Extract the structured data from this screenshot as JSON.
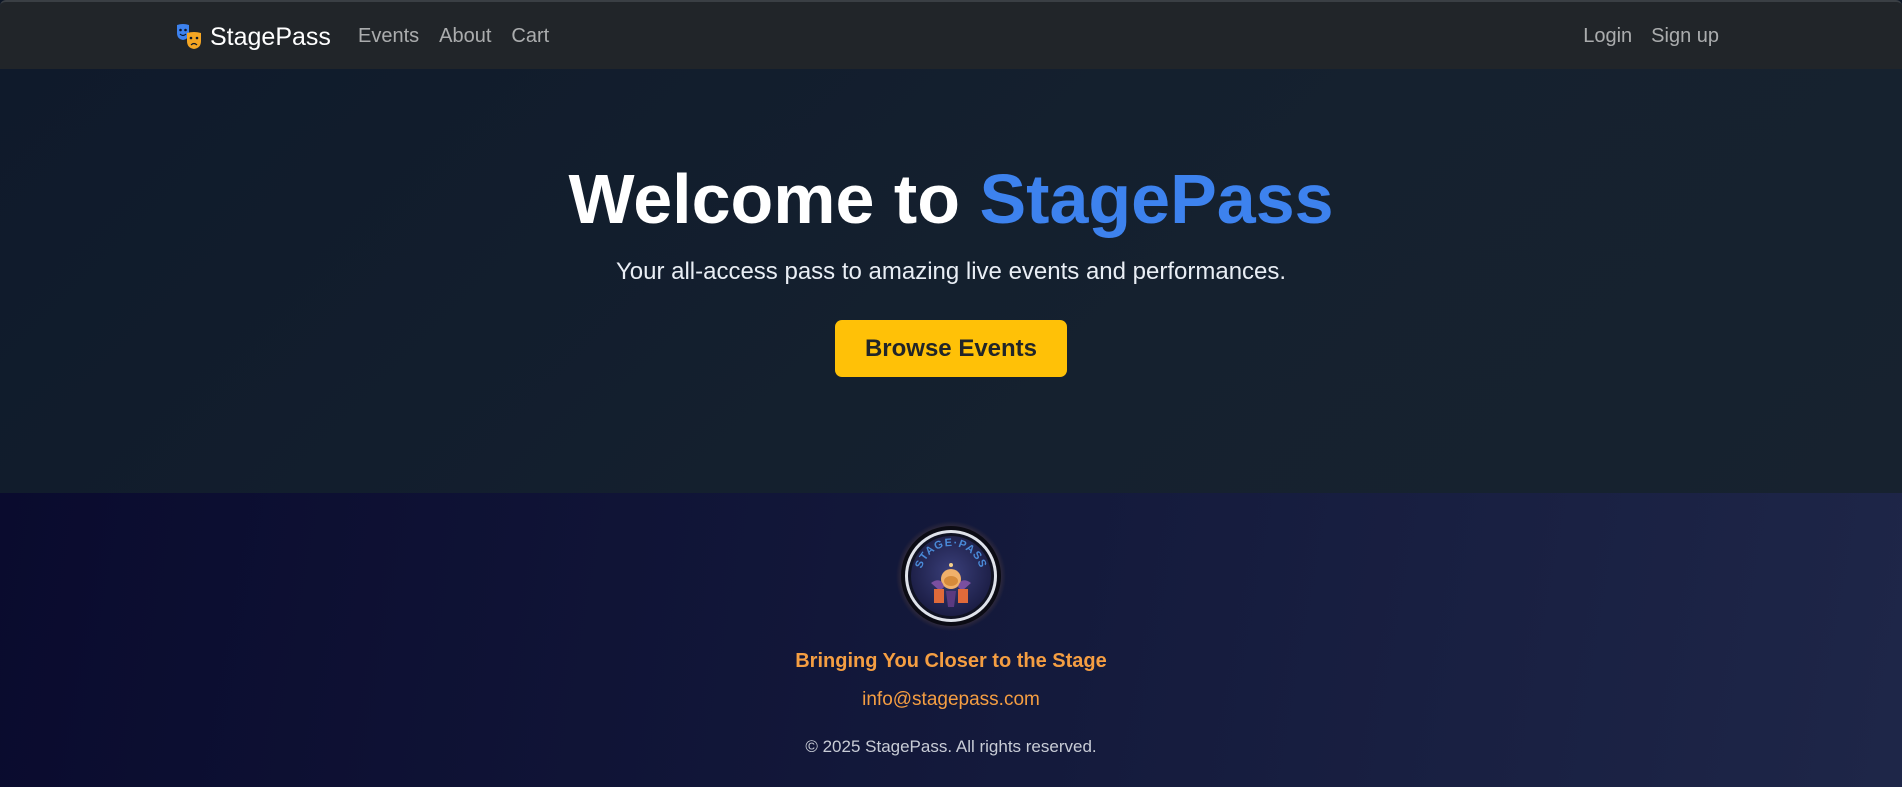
{
  "nav": {
    "brand": "StagePass",
    "brand_icon": "theater-masks-icon",
    "links": [
      "Events",
      "About",
      "Cart"
    ],
    "auth": [
      "Login",
      "Sign up"
    ]
  },
  "hero": {
    "title_prefix": "Welcome to",
    "title_accent": "StagePass",
    "subtitle": "Your all-access pass to amazing live events and performances.",
    "button": "Browse Events"
  },
  "footer": {
    "logo_text": "STAGE·PASS",
    "tagline": "Bringing You Closer to the Stage",
    "email": "info@stagepass.com",
    "copyright": "© 2025 StagePass. All rights reserved."
  },
  "colors": {
    "navbar": "#212529",
    "accent_blue": "#3d82ee",
    "button_yellow": "#ffc107",
    "footer_orange": "#f59e42"
  }
}
